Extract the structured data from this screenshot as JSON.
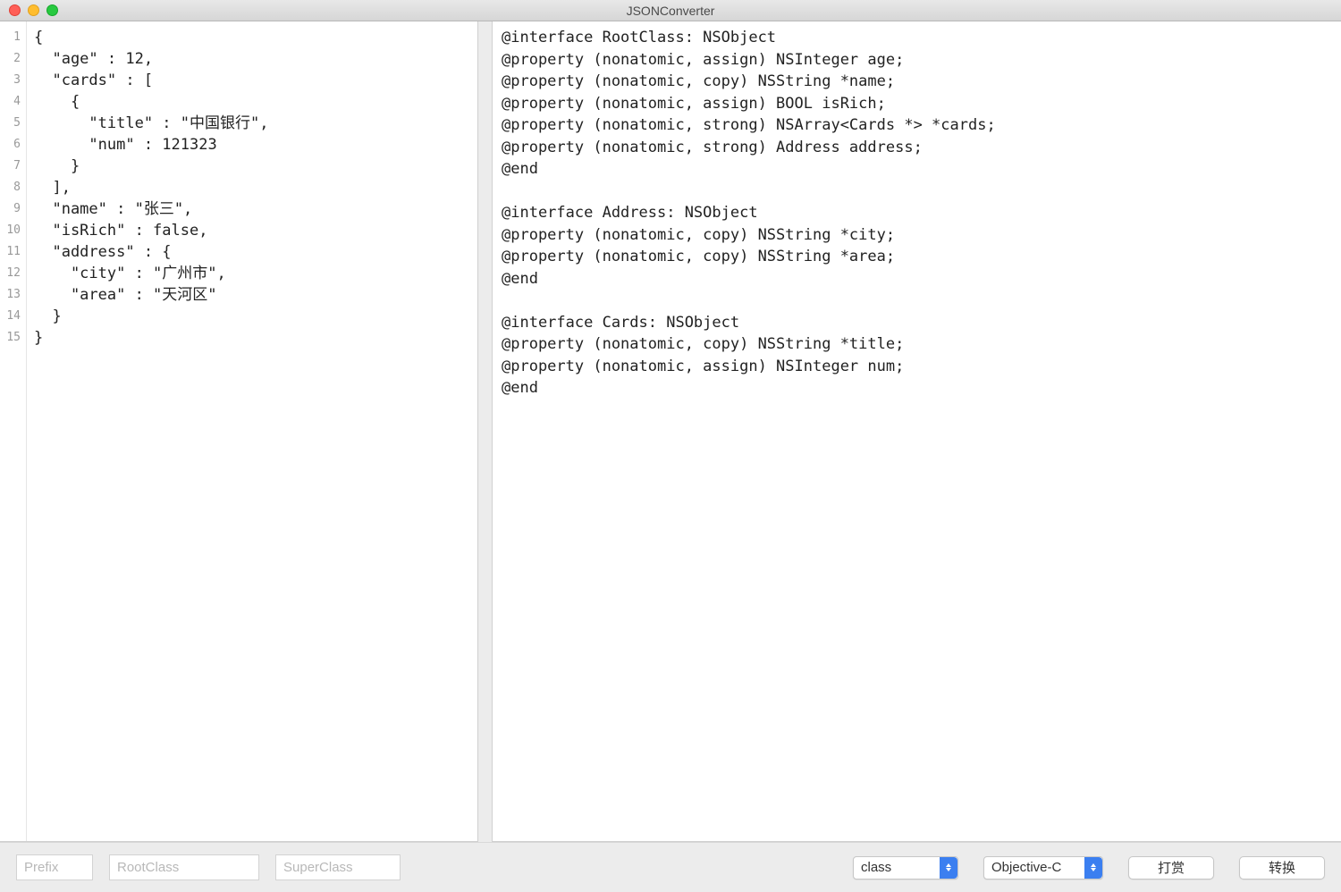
{
  "window": {
    "title": "JSONConverter"
  },
  "editor": {
    "line_numbers": [
      "1",
      "2",
      "3",
      "4",
      "5",
      "6",
      "7",
      "8",
      "9",
      "10",
      "11",
      "12",
      "13",
      "14",
      "15"
    ],
    "json_lines": [
      "{",
      "  \"age\" : 12,",
      "  \"cards\" : [",
      "    {",
      "      \"title\" : \"中国银行\",",
      "      \"num\" : 121323",
      "    }",
      "  ],",
      "  \"name\" : \"张三\",",
      "  \"isRich\" : false,",
      "  \"address\" : {",
      "    \"city\" : \"广州市\",",
      "    \"area\" : \"天河区\"",
      "  }",
      "}"
    ]
  },
  "output": {
    "lines": [
      "@interface RootClass: NSObject",
      "@property (nonatomic, assign) NSInteger age;",
      "@property (nonatomic, copy) NSString *name;",
      "@property (nonatomic, assign) BOOL isRich;",
      "@property (nonatomic, strong) NSArray<Cards *> *cards;",
      "@property (nonatomic, strong) Address address;",
      "@end",
      "",
      "@interface Address: NSObject",
      "@property (nonatomic, copy) NSString *city;",
      "@property (nonatomic, copy) NSString *area;",
      "@end",
      "",
      "@interface Cards: NSObject",
      "@property (nonatomic, copy) NSString *title;",
      "@property (nonatomic, assign) NSInteger num;",
      "@end"
    ]
  },
  "toolbar": {
    "prefix_placeholder": "Prefix",
    "rootclass_placeholder": "RootClass",
    "superclass_placeholder": "SuperClass",
    "select_type_value": "class",
    "select_lang_value": "Objective-C",
    "reward_label": "打赏",
    "convert_label": "转换"
  }
}
